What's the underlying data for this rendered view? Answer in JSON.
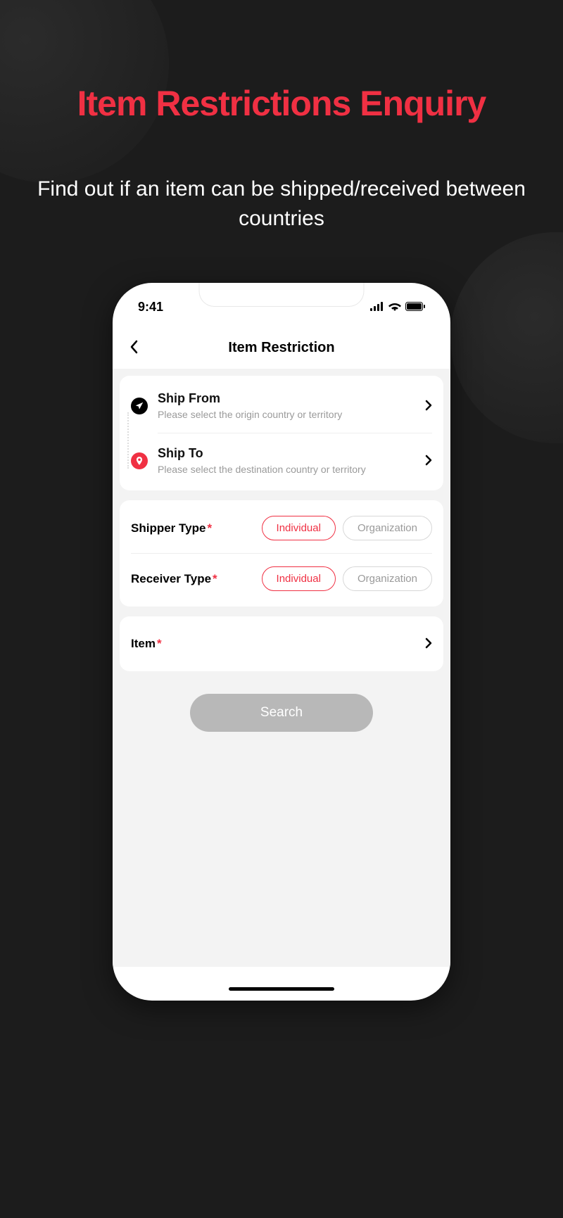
{
  "promo": {
    "title": "Item Restrictions Enquiry",
    "subtitle": "Find out if an item can be shipped/received between countries"
  },
  "status": {
    "time": "9:41"
  },
  "nav": {
    "title": "Item Restriction"
  },
  "ship_from": {
    "label": "Ship From",
    "placeholder": "Please select the origin country or territory"
  },
  "ship_to": {
    "label": "Ship To",
    "placeholder": "Please select the destination country or territory"
  },
  "shipper_type": {
    "label": "Shipper Type",
    "options": {
      "individual": "Individual",
      "organization": "Organization"
    },
    "selected": "individual"
  },
  "receiver_type": {
    "label": "Receiver Type",
    "options": {
      "individual": "Individual",
      "organization": "Organization"
    },
    "selected": "individual"
  },
  "item": {
    "label": "Item"
  },
  "search_button": "Search"
}
